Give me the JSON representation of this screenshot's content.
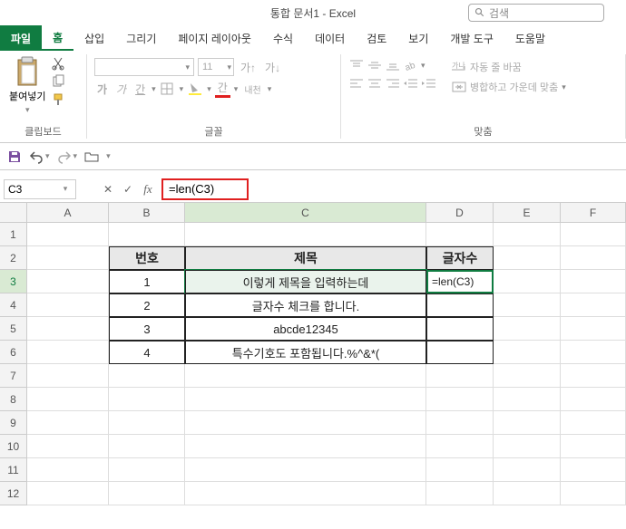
{
  "window_title": "통합 문서1 - Excel",
  "search_placeholder": "검색",
  "tabs": {
    "file": "파일",
    "home": "홈",
    "insert": "삽입",
    "draw": "그리기",
    "pagelayout": "페이지 레이아웃",
    "formulas": "수식",
    "data": "데이터",
    "review": "검토",
    "view": "보기",
    "developer": "개발 도구",
    "help": "도움말"
  },
  "ribbon": {
    "clipboard": {
      "title": "클립보드",
      "paste": "붙여넣기"
    },
    "font": {
      "title": "글꼴",
      "size": "11",
      "bold": "가",
      "italic": "가",
      "underline": "간"
    },
    "align": {
      "title": "맞춤",
      "wrap": "자동 줄 바꿈",
      "merge": "병합하고 가운데 맞춤"
    }
  },
  "name_box": "C3",
  "formula": "=len(C3)",
  "columns": [
    "A",
    "B",
    "C",
    "D",
    "E",
    "F"
  ],
  "rows": [
    "1",
    "2",
    "3",
    "4",
    "5",
    "6",
    "7",
    "8",
    "9",
    "10",
    "11",
    "12"
  ],
  "chart_data": {
    "type": "table",
    "headers": {
      "b2": "번호",
      "c2": "제목",
      "d2": "글자수"
    },
    "rows": [
      {
        "b": "1",
        "c": "이렇게 제목을 입력하는데",
        "d": "=len(C3)"
      },
      {
        "b": "2",
        "c": "글자수 체크를 합니다.",
        "d": ""
      },
      {
        "b": "3",
        "c": "abcde12345",
        "d": ""
      },
      {
        "b": "4",
        "c": "특수기호도 포함됩니다.%^&*(",
        "d": ""
      }
    ]
  }
}
